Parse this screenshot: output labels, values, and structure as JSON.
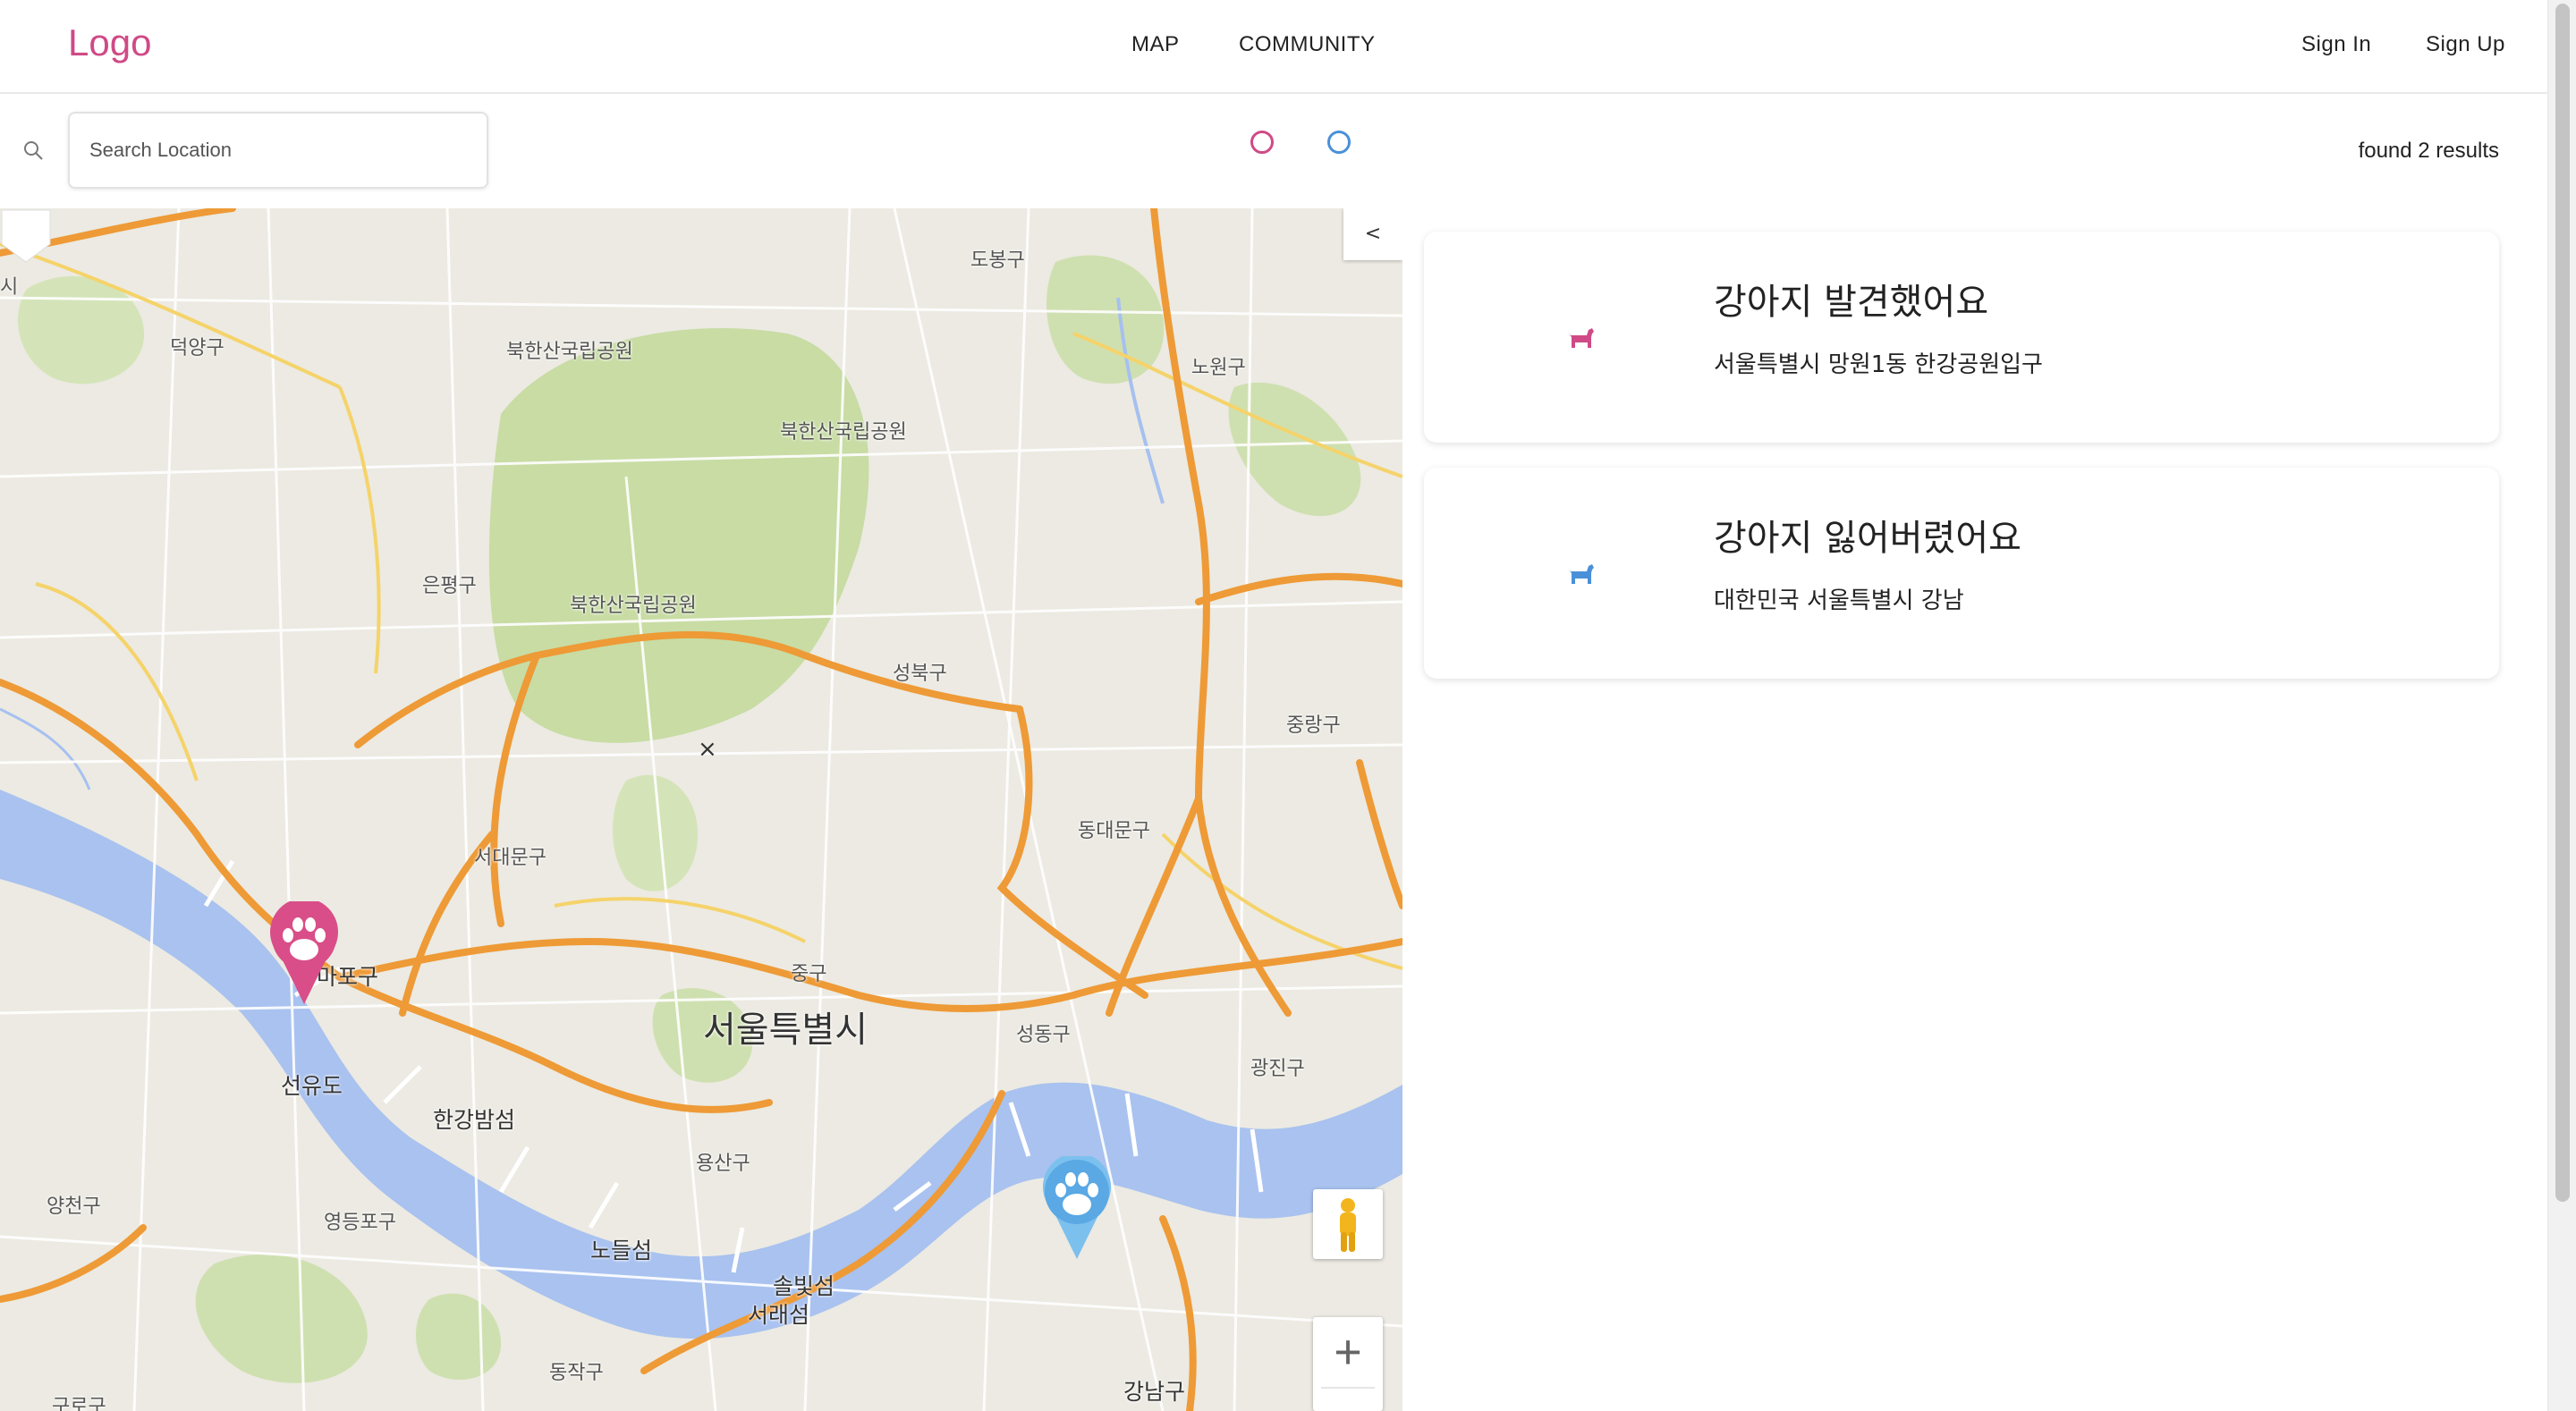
{
  "header": {
    "logo": "Logo",
    "nav": [
      "MAP",
      "COMMUNITY"
    ],
    "sign_in": "Sign In",
    "sign_up": "Sign Up"
  },
  "search": {
    "placeholder": "Search Location",
    "value": ""
  },
  "filters": {
    "found_color": "#cf4a86",
    "lost_color": "#4a90d9"
  },
  "results_text": "found 2 results",
  "map": {
    "collapse_label": "<",
    "zoom_in_label": "+",
    "close_label": "×",
    "labels": {
      "dobong": "도봉구",
      "deogyang": "덕양구",
      "bukhansan1": "북한산국립공원",
      "bukhansan2": "북한산국립공원",
      "bukhansan3": "북한산국립공원",
      "nowon": "노원구",
      "eunpyeong": "은평구",
      "seongbuk": "성북구",
      "jungnang": "중랑구",
      "dongdaemun": "동대문구",
      "seodaemun": "서대문구",
      "mapo": "마포구",
      "junggu": "중구",
      "seoul": "서울특별시",
      "seongdong": "성동구",
      "gwangjin": "광진구",
      "seonyudo": "선유도",
      "hangang": "한강밤섬",
      "yongsan": "용산구",
      "yangcheon": "양천구",
      "yeongdeungpo": "영등포구",
      "nodeul": "노들섬",
      "seorae": "서래섬",
      "solbit": "솔빛섬",
      "dongjak": "동작구",
      "guro": "구로구",
      "gangnam": "강남구",
      "edge_si": "시"
    }
  },
  "posts": [
    {
      "title": "강아지 발견했어요",
      "address": "서울특별시 망원1동 한강공원입구",
      "type": "found",
      "color": "#cf4a86"
    },
    {
      "title": "강아지 잃어버렸어요",
      "address": "대한민국 서울특별시 강남",
      "type": "lost",
      "color": "#4a90d9"
    }
  ]
}
